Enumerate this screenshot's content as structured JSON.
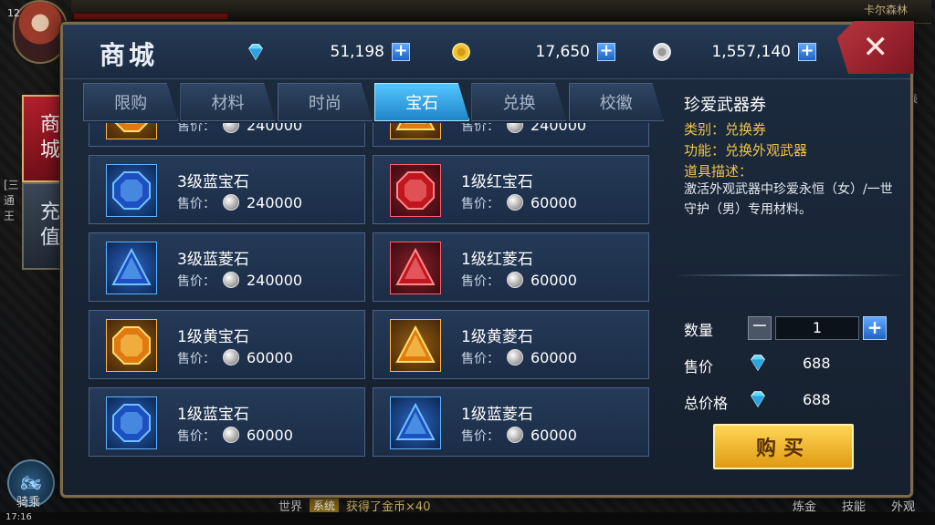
{
  "world": {
    "location": "卡尔森林",
    "level": "12",
    "side_tabs": [
      "商城",
      "充值"
    ],
    "left_strip": "[三 通 王",
    "ride_label": "骑乘",
    "time": "17:16",
    "chat_channel": "世界",
    "chat_sys": "系统",
    "chat_msg": "获得了金币×40",
    "bottom_buttons": [
      "炼金",
      "技能",
      "外观"
    ],
    "right_strip": "线"
  },
  "shop": {
    "title": "商城",
    "currencies": [
      {
        "icon": "diamond-icon",
        "value": "51,198"
      },
      {
        "icon": "gold-coin-icon",
        "value": "17,650"
      },
      {
        "icon": "silver-coin-icon",
        "value": "1,557,140"
      }
    ],
    "close": "✕",
    "tabs": [
      "限购",
      "材料",
      "时尚",
      "宝石",
      "兑换",
      "校徽"
    ],
    "active_tab": "宝石",
    "price_label": "售价：",
    "items": [
      {
        "name": "",
        "price": "240000",
        "color": "yellow",
        "shape": "octagon"
      },
      {
        "name": "",
        "price": "240000",
        "color": "yellow",
        "shape": "triangle"
      },
      {
        "name": "3级蓝宝石",
        "price": "240000",
        "color": "blue",
        "shape": "octagon"
      },
      {
        "name": "1级红宝石",
        "price": "60000",
        "color": "red",
        "shape": "octagon"
      },
      {
        "name": "3级蓝菱石",
        "price": "240000",
        "color": "blue",
        "shape": "triangle"
      },
      {
        "name": "1级红菱石",
        "price": "60000",
        "color": "red",
        "shape": "triangle"
      },
      {
        "name": "1级黄宝石",
        "price": "60000",
        "color": "yellow",
        "shape": "octagon"
      },
      {
        "name": "1级黄菱石",
        "price": "60000",
        "color": "yellow",
        "shape": "triangle"
      },
      {
        "name": "1级蓝宝石",
        "price": "60000",
        "color": "blue",
        "shape": "octagon"
      },
      {
        "name": "1级蓝菱石",
        "price": "60000",
        "color": "blue",
        "shape": "triangle"
      }
    ],
    "detail": {
      "title": "珍爱武器券",
      "category": "类别：兑换券",
      "function": "功能：兑换外观武器",
      "desc_label": "道具描述：",
      "desc": "激活外观武器中珍爱永恒（女）/一世守护（男）专用材料。",
      "qty_label": "数量",
      "qty": "1",
      "minus": "−",
      "plus": "+",
      "price_label": "售价",
      "price": "688",
      "total_label": "总价格",
      "total": "688",
      "buy": "购买"
    }
  }
}
